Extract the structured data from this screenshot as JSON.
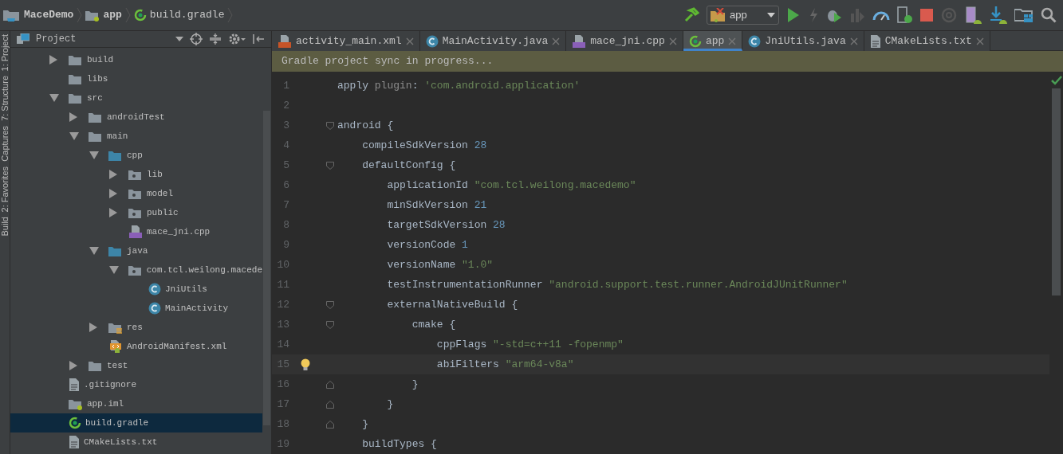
{
  "breadcrumbs": [
    {
      "label": "MaceDemo",
      "kind": "project"
    },
    {
      "label": "app",
      "kind": "module"
    },
    {
      "label": "build.gradle",
      "kind": "gradle"
    }
  ],
  "run_config": {
    "label": "app"
  },
  "tool_strip": [
    "1: Project",
    "7: Structure",
    "Captures",
    "2: Favorites",
    "Build"
  ],
  "project_panel": {
    "title": "Project",
    "tree": [
      {
        "label": "build",
        "kind": "folder",
        "expanded": false,
        "selected": false
      },
      {
        "label": "libs",
        "kind": "folder",
        "selected": false
      },
      {
        "label": "src",
        "kind": "folder",
        "expanded": true,
        "selected": false,
        "children": [
          {
            "label": "androidTest",
            "kind": "folder",
            "expanded": false,
            "selected": false
          },
          {
            "label": "main",
            "kind": "folder",
            "expanded": true,
            "selected": false,
            "children": [
              {
                "label": "cpp",
                "kind": "source-folder",
                "expanded": true,
                "selected": false,
                "children": [
                  {
                    "label": "lib",
                    "kind": "package",
                    "expanded": false,
                    "selected": false
                  },
                  {
                    "label": "model",
                    "kind": "package",
                    "expanded": false,
                    "selected": false
                  },
                  {
                    "label": "public",
                    "kind": "package",
                    "expanded": false,
                    "selected": false
                  },
                  {
                    "label": "mace_jni.cpp",
                    "kind": "cpp",
                    "selected": false
                  }
                ]
              },
              {
                "label": "java",
                "kind": "source-folder",
                "expanded": true,
                "selected": false,
                "children": [
                  {
                    "label": "com.tcl.weilong.macede",
                    "kind": "package",
                    "expanded": true,
                    "selected": false,
                    "children": [
                      {
                        "label": "JniUtils",
                        "kind": "class",
                        "selected": false
                      },
                      {
                        "label": "MainActivity",
                        "kind": "class",
                        "selected": false
                      }
                    ]
                  }
                ]
              },
              {
                "label": "res",
                "kind": "res-folder",
                "expanded": false,
                "selected": false
              },
              {
                "label": "AndroidManifest.xml",
                "kind": "manifest",
                "selected": false
              }
            ]
          },
          {
            "label": "test",
            "kind": "folder",
            "expanded": false,
            "selected": false
          }
        ]
      },
      {
        "label": ".gitignore",
        "kind": "text",
        "selected": false
      },
      {
        "label": "app.iml",
        "kind": "module",
        "selected": false
      },
      {
        "label": "build.gradle",
        "kind": "gradle",
        "selected": true
      },
      {
        "label": "CMakeLists.txt",
        "kind": "text",
        "selected": false
      }
    ]
  },
  "tabs": [
    {
      "label": "activity_main.xml",
      "kind": "xml",
      "selected": false
    },
    {
      "label": "MainActivity.java",
      "kind": "class",
      "selected": false
    },
    {
      "label": "mace_jni.cpp",
      "kind": "cpp",
      "selected": false
    },
    {
      "label": "app",
      "kind": "gradle",
      "selected": true
    },
    {
      "label": "JniUtils.java",
      "kind": "class",
      "selected": false
    },
    {
      "label": "CMakeLists.txt",
      "kind": "text",
      "selected": false
    }
  ],
  "banner": "Gradle project sync in progress...",
  "code": [
    {
      "number": "1",
      "kind": "plain",
      "current": false,
      "tokens": [
        {
          "kind": "plain",
          "text": "apply "
        },
        {
          "kind": "label",
          "text": "plugin"
        },
        {
          "kind": "plain",
          "text": ": "
        },
        {
          "kind": "string",
          "text": "'com.android.application'"
        }
      ]
    },
    {
      "number": "2",
      "kind": "plain",
      "current": false
    },
    {
      "number": "3",
      "kind": "fold-start",
      "current": false,
      "tokens": [
        {
          "kind": "plain",
          "text": "android {"
        }
      ]
    },
    {
      "number": "4",
      "kind": "plain",
      "current": false,
      "tokens": [
        {
          "kind": "plain",
          "text": "    compileSdkVersion "
        },
        {
          "kind": "number",
          "text": "28"
        }
      ]
    },
    {
      "number": "5",
      "kind": "fold-start",
      "current": false,
      "tokens": [
        {
          "kind": "plain",
          "text": "    defaultConfig {"
        }
      ]
    },
    {
      "number": "6",
      "kind": "plain",
      "current": false,
      "tokens": [
        {
          "kind": "plain",
          "text": "        applicationId "
        },
        {
          "kind": "string",
          "text": "\"com.tcl.weilong.macedemo\""
        }
      ]
    },
    {
      "number": "7",
      "kind": "plain",
      "current": false,
      "tokens": [
        {
          "kind": "plain",
          "text": "        minSdkVersion "
        },
        {
          "kind": "number",
          "text": "21"
        }
      ]
    },
    {
      "number": "8",
      "kind": "plain",
      "current": false,
      "tokens": [
        {
          "kind": "plain",
          "text": "        targetSdkVersion "
        },
        {
          "kind": "number",
          "text": "28"
        }
      ]
    },
    {
      "number": "9",
      "kind": "plain",
      "current": false,
      "tokens": [
        {
          "kind": "plain",
          "text": "        versionCode "
        },
        {
          "kind": "number",
          "text": "1"
        }
      ]
    },
    {
      "number": "10",
      "kind": "plain",
      "current": false,
      "tokens": [
        {
          "kind": "plain",
          "text": "        versionName "
        },
        {
          "kind": "string",
          "text": "\"1.0\""
        }
      ]
    },
    {
      "number": "11",
      "kind": "plain",
      "current": false,
      "tokens": [
        {
          "kind": "plain",
          "text": "        testInstrumentationRunner "
        },
        {
          "kind": "string",
          "text": "\"android.support.test.runner.AndroidJUnitRunner\""
        }
      ]
    },
    {
      "number": "12",
      "kind": "fold-start",
      "current": false,
      "tokens": [
        {
          "kind": "plain",
          "text": "        externalNativeBuild {"
        }
      ]
    },
    {
      "number": "13",
      "kind": "fold-start",
      "current": false,
      "tokens": [
        {
          "kind": "plain",
          "text": "            cmake {"
        }
      ]
    },
    {
      "number": "14",
      "kind": "plain",
      "current": false,
      "tokens": [
        {
          "kind": "plain",
          "text": "                cppFlags "
        },
        {
          "kind": "string",
          "text": "\"-std=c++11 -fopenmp\""
        }
      ]
    },
    {
      "number": "15",
      "kind": "plain",
      "current": true,
      "tokens": [
        {
          "kind": "plain",
          "text": "                abiFilters "
        },
        {
          "kind": "string",
          "text": "\"arm64-v8a\""
        }
      ]
    },
    {
      "number": "16",
      "kind": "fold-end",
      "current": false,
      "tokens": [
        {
          "kind": "plain",
          "text": "            }"
        }
      ]
    },
    {
      "number": "17",
      "kind": "fold-end",
      "current": false,
      "tokens": [
        {
          "kind": "plain",
          "text": "        }"
        }
      ]
    },
    {
      "number": "18",
      "kind": "fold-end",
      "current": false,
      "tokens": [
        {
          "kind": "plain",
          "text": "    }"
        }
      ]
    },
    {
      "number": "19",
      "kind": "plain",
      "current": false,
      "tokens": [
        {
          "kind": "plain",
          "text": "    buildTypes {"
        }
      ]
    }
  ]
}
